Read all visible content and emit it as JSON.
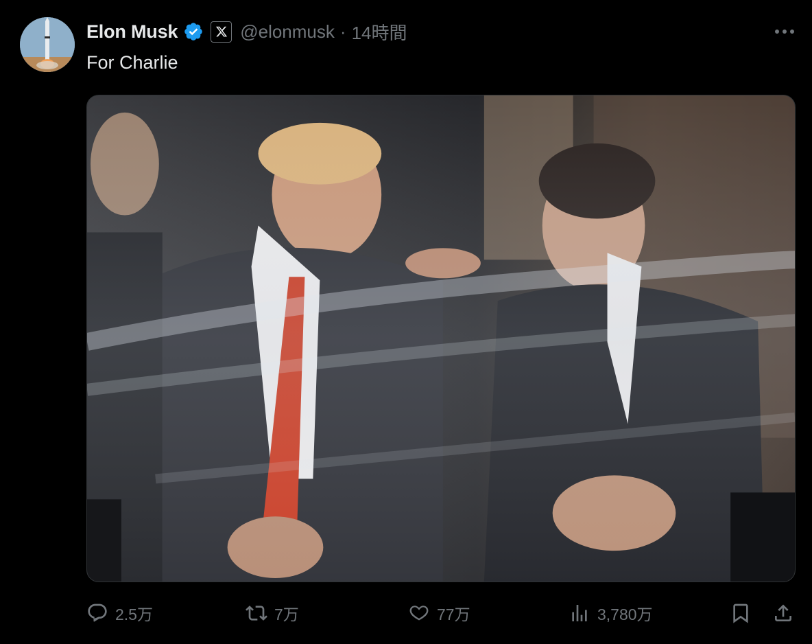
{
  "author": {
    "display_name": "Elon Musk",
    "handle": "@elonmusk",
    "separator": "·",
    "timestamp": "14時間",
    "avatar_icon": "rocket-launch-avatar",
    "verified_icon": "verified-badge-icon",
    "affiliation_icon": "x-logo-icon"
  },
  "post": {
    "text": "For Charlie",
    "media_type": "photo"
  },
  "actions": {
    "reply_count": "2.5万",
    "repost_count": "7万",
    "like_count": "77万",
    "view_count": "3,780万"
  },
  "colors": {
    "background": "#000000",
    "primary_text": "#e7e9ea",
    "secondary_text": "#71767b",
    "verified_blue": "#1d9bf0",
    "border": "#2f3336"
  }
}
